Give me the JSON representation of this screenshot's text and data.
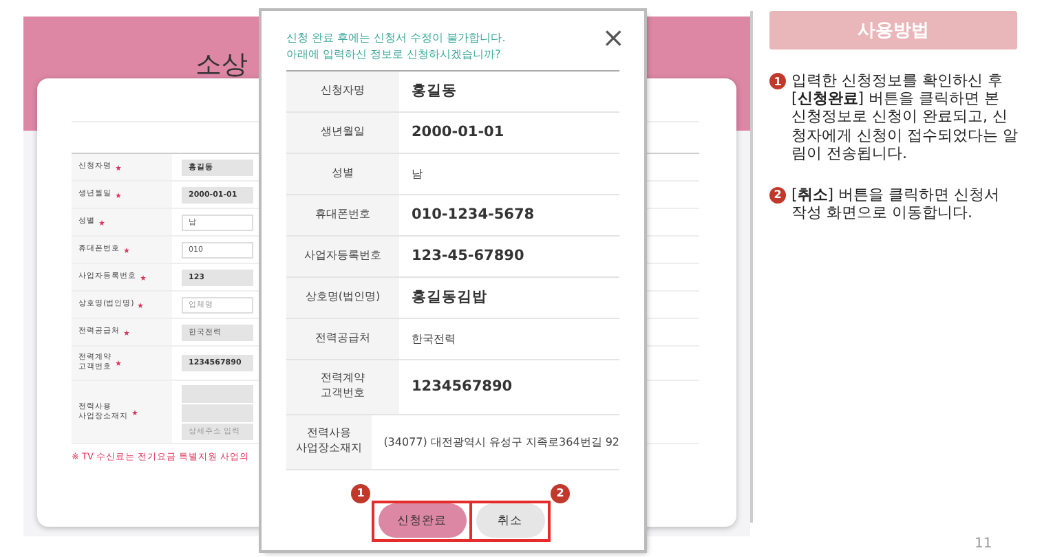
{
  "background_form": {
    "title": "소상",
    "rows": [
      {
        "label": "신청자명",
        "required": true,
        "kind": "readonly",
        "value": "홍길동"
      },
      {
        "label": "생년월일",
        "required": true,
        "kind": "readonly",
        "value": "2000-01-01"
      },
      {
        "label": "성별",
        "required": true,
        "kind": "input",
        "value": "남"
      },
      {
        "label": "휴대폰번호",
        "required": true,
        "kind": "input",
        "value": "010"
      },
      {
        "label": "사업자등록번호",
        "required": true,
        "kind": "readonly",
        "value": "123"
      },
      {
        "label": "상호명(법인명)",
        "required": true,
        "kind": "input",
        "placeholder": "업체명"
      },
      {
        "label": "전력공급처",
        "required": true,
        "kind": "readonly_plain",
        "value": "한국전력"
      },
      {
        "label": "전력계약\n고객번호",
        "required": true,
        "kind": "readonly",
        "value": "1234567890"
      },
      {
        "label": "전력사용\n사업장소재지",
        "required": true,
        "kind": "address",
        "placeholder": "상세주소 입력"
      }
    ],
    "notice": "※ TV 수신료는 전기요금 특별지원 사업의"
  },
  "dialog": {
    "message": "신청 완료 후에는 신청서 수정이 불가합니다.\n아래에 입력하신 정보로 신청하시겠습니까?",
    "close": "×",
    "rows": [
      {
        "label": "신청자명",
        "value": "홍길동",
        "bold": true
      },
      {
        "label": "생년월일",
        "value": "2000-01-01",
        "bold": true
      },
      {
        "label": "성별",
        "value": "남",
        "bold": false
      },
      {
        "label": "휴대폰번호",
        "value": "010-1234-5678",
        "bold": true
      },
      {
        "label": "사업자등록번호",
        "value": "123-45-67890",
        "bold": true
      },
      {
        "label": "상호명(법인명)",
        "value": "홍길동김밥",
        "bold": true
      },
      {
        "label": "전력공급처",
        "value": "한국전력",
        "bold": false
      },
      {
        "label": "전력계약\n고객번호",
        "value": "1234567890",
        "bold": true
      },
      {
        "label": "전력사용\n사업장소재지",
        "value": "(34077) 대전광역시 유성구 지족로364번길 92",
        "bold": false
      }
    ],
    "buttons": [
      {
        "label": "신청완료",
        "kind": "primary",
        "callout": "1"
      },
      {
        "label": "취소",
        "kind": "secondary",
        "callout": "2"
      }
    ]
  },
  "guide": {
    "title": "사용방법",
    "steps": [
      {
        "number": "1",
        "text": "입력한 신청정보를 확인하신 후 [**신청완료**] 버튼을 클릭하면 본 신청정보로 신청이 완료되고, 신청자에게 신청이 접수되었다는 알림이 전송됩니다."
      },
      {
        "number": "2",
        "text": "[**취소**] 버튼을 클릭하면 신청서 작성 화면으로 이동합니다."
      }
    ]
  },
  "page_number": "11"
}
